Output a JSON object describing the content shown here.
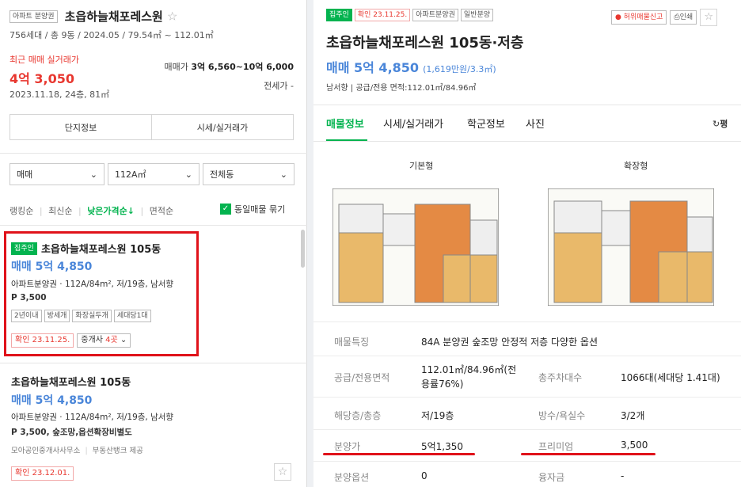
{
  "left": {
    "header": {
      "tag": "아파트 분양권",
      "title": "초읍하늘채포레스원",
      "sub": "756세대 / 총 9동 / 2024.05 / 79.54㎡ ~ 112.01㎡"
    },
    "recent": {
      "label": "최근 매매 실거래가",
      "price": "4억 3,050",
      "date": "2023.11.18, 24층, 81㎡",
      "sale_label": "매매가",
      "sale_value": "3억 6,560~10억 6,000",
      "jeonse_label": "전세가",
      "jeonse_value": "-"
    },
    "buttons": {
      "complex_info": "단지정보",
      "market": "시세/실거래가"
    },
    "filters": {
      "type": "매매",
      "area": "112A㎡",
      "dong": "전체동"
    },
    "sort": {
      "ranking": "랭킹순",
      "latest": "최신순",
      "low_price": "낮은가격순↓",
      "area": "면적순",
      "group_label": "동일매물 묶기"
    },
    "listings": [
      {
        "tag": "집주인",
        "title": "초읍하늘채포레스원 105동",
        "price": "매매 5억 4,850",
        "desc": "아파트분양권 · 112A/84m², 저/19층, 남서향",
        "premium": "P 3,500",
        "chips": [
          "2년이내",
          "방세개",
          "화장실두개",
          "세대당1대"
        ],
        "confirm": "확인 23.11.25.",
        "agents": "중개사",
        "agents_count": "4곳"
      },
      {
        "title": "초읍하늘채포레스원 105동",
        "price": "매매 5억 4,850",
        "desc": "아파트분양권 · 112A/84m², 저/19층, 남서향",
        "premium": "P 3,500, 숲조망,옵션확장비별도",
        "source1": "모아공인중개사사무소",
        "source2": "부동산뱅크 제공",
        "confirm": "확인 23.12.01."
      }
    ]
  },
  "right": {
    "tags": {
      "owner": "집주인",
      "confirm": "확인 23.11.25.",
      "type": "아파트분양권",
      "sale": "일반분양"
    },
    "actions": {
      "report": "허위매물신고",
      "print": "인쇄"
    },
    "title": "초읍하늘채포레스원 105동·저층",
    "price": "매매 5억 4,850",
    "price_unit": "(1,619만원/3.3㎡)",
    "subinfo": "남서향 | 공급/전용 면적:112.01㎡/84.96㎡",
    "tabs": [
      "매물정보",
      "시세/실거래가",
      "학군정보",
      "사진"
    ],
    "tab_extra": "평",
    "plans": {
      "basic": "기본형",
      "expanded": "확장형"
    },
    "detail": {
      "feature_label": "매물특징",
      "feature": "84A 분양권 숲조망 안정적 저층 다양한 옵션",
      "area_label": "공급/전용면적",
      "area_value": "112.01㎡/84.96㎡(전용률76%)",
      "park_label": "총주차대수",
      "park_value": "1066대(세대당 1.41대)",
      "floor_label": "해당층/총층",
      "floor_value": "저/19층",
      "rooms_label": "방수/욕실수",
      "rooms_value": "3/2개",
      "presale_label": "분양가",
      "presale_value": "5억1,350",
      "premium_label": "프리미엄",
      "premium_value": "3,500",
      "option_label": "분양옵션",
      "option_value": "0",
      "loan_label": "융자금",
      "loan_value": "-"
    }
  },
  "colors": {
    "green": "#03b34f",
    "red": "#e8372f",
    "blue": "#4a86d9",
    "highlight": "#e0121a"
  }
}
